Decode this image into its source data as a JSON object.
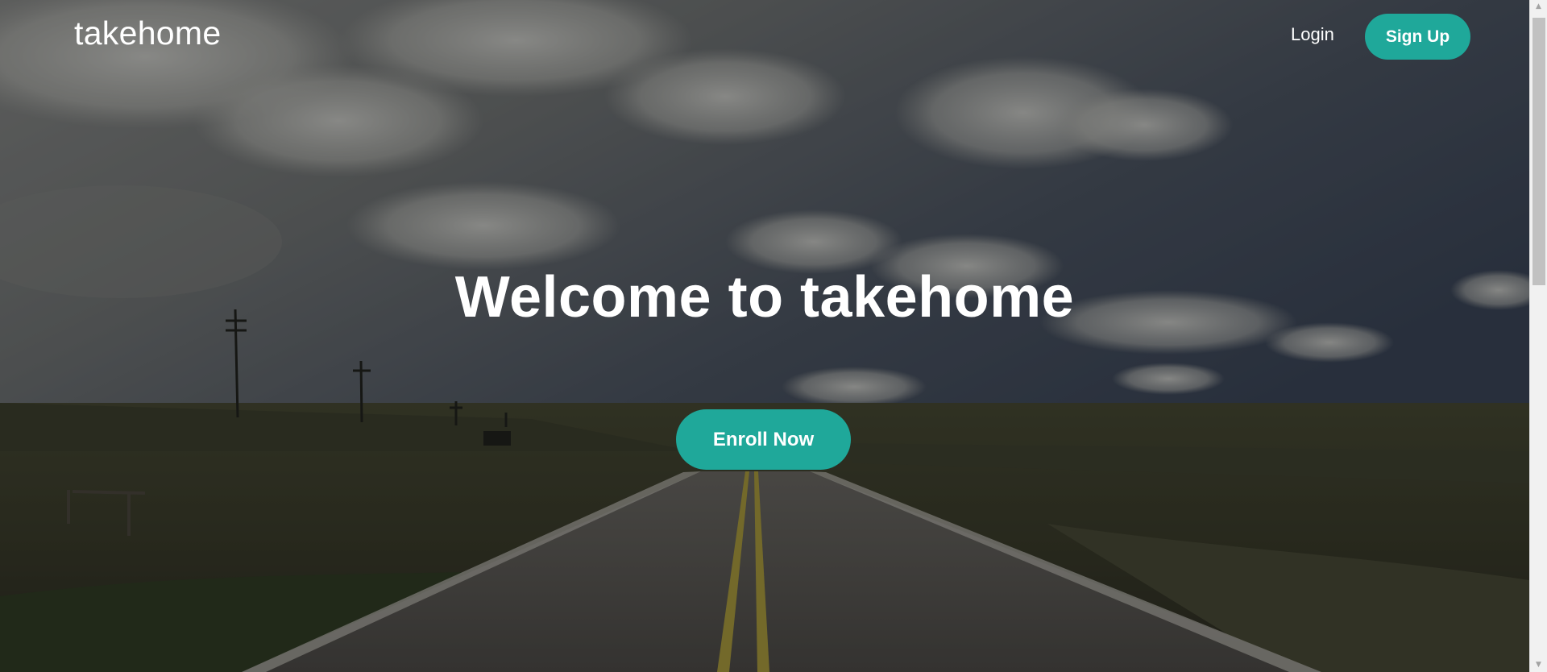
{
  "header": {
    "logo": "takehome",
    "login_label": "Login",
    "signup_label": "Sign Up"
  },
  "hero": {
    "title": "Welcome to takehome",
    "cta_label": "Enroll Now"
  },
  "colors": {
    "accent": "#1fa89a",
    "text": "#ffffff"
  },
  "icons": {
    "scroll_up": "scroll-up-arrow-icon",
    "scroll_down": "scroll-down-arrow-icon"
  }
}
